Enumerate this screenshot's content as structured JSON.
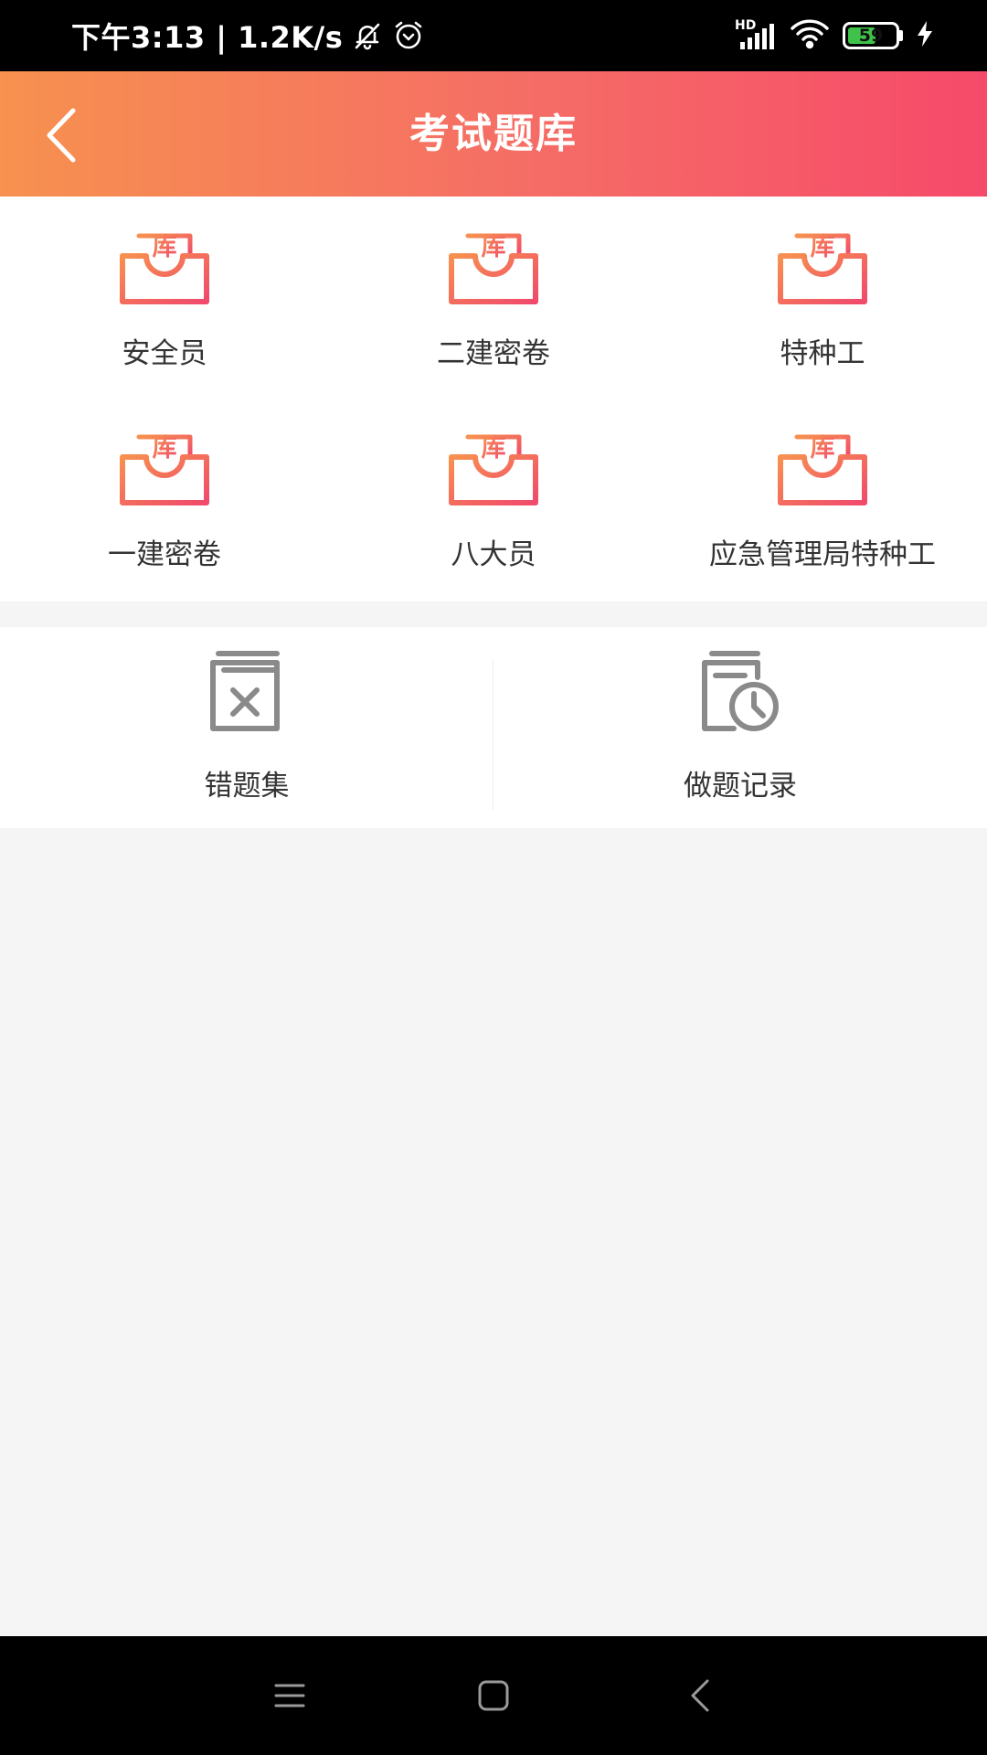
{
  "status_bar": {
    "time_and_speed": "下午3:13 | 1.2K/s",
    "network_type": "HD",
    "battery_level": "59",
    "battery_fraction": 0.59
  },
  "header": {
    "title": "考试题库",
    "icon": "chevron-left-icon"
  },
  "categories": [
    {
      "label": "安全员",
      "icon_text": "库"
    },
    {
      "label": "二建密卷",
      "icon_text": "库"
    },
    {
      "label": "特种工",
      "icon_text": "库"
    },
    {
      "label": "一建密卷",
      "icon_text": "库"
    },
    {
      "label": "八大员",
      "icon_text": "库"
    },
    {
      "label": "应急管理局特种工",
      "icon_text": "库"
    }
  ],
  "tools": [
    {
      "label": "错题集",
      "icon": "wrong-questions-icon"
    },
    {
      "label": "做题记录",
      "icon": "history-record-icon"
    }
  ],
  "colors": {
    "header_gradient_start": "#f7914f",
    "header_gradient_end": "#f64a6a",
    "icon_gradient_start": "#f7914f",
    "icon_gradient_end": "#f0496c",
    "tool_icon": "#8a8a8a"
  },
  "nav_bar": {
    "buttons": [
      "menu-icon",
      "home-icon",
      "back-icon"
    ]
  }
}
